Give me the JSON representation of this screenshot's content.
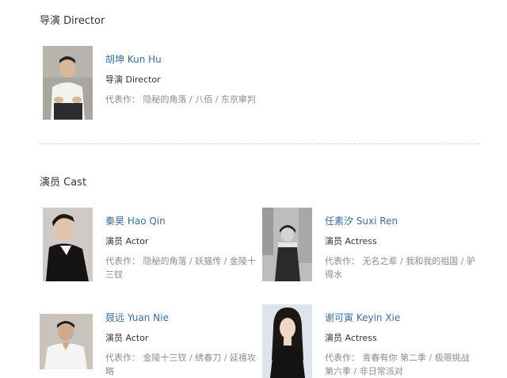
{
  "director_section": {
    "title": "导演 Director",
    "people": [
      {
        "name": "胡坤 Kun Hu",
        "role": "导演 Director",
        "works_label": "代表作：",
        "works": [
          "隐秘的角落",
          "八佰",
          "东京审判"
        ]
      }
    ]
  },
  "cast_section": {
    "title": "演员 Cast",
    "people": [
      {
        "name": "秦昊 Hao Qin",
        "role": "演员 Actor",
        "works_label": "代表作：",
        "works": [
          "隐秘的角落",
          "妖猫传",
          "金陵十三钗"
        ]
      },
      {
        "name": "任素汐 Suxi Ren",
        "role": "演员 Actress",
        "works_label": "代表作：",
        "works": [
          "无名之辈",
          "我和我的祖国",
          "驴得水"
        ]
      },
      {
        "name": "聂远 Yuan Nie",
        "role": "演员 Actor",
        "works_label": "代表作：",
        "works": [
          "金陵十三钗",
          "绣春刀",
          "延禧攻略"
        ]
      },
      {
        "name": "谢可寅 Keyin Xie",
        "role": "演员 Actress",
        "works_label": "代表作：",
        "works": [
          "青春有你 第二季",
          "极限挑战 第六季",
          "非日常派对"
        ]
      }
    ]
  },
  "separator": " / "
}
